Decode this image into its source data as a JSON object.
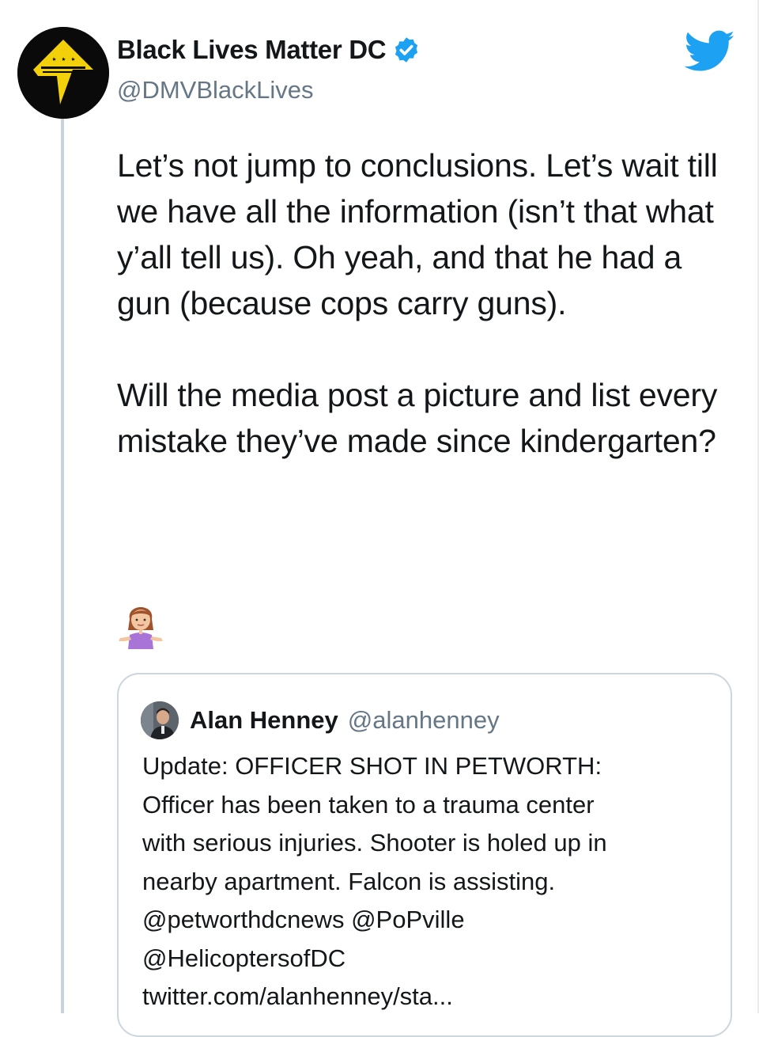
{
  "tweet": {
    "display_name": "Black Lives Matter DC",
    "handle": "@DMVBlackLives",
    "paragraph_1": "Let’s not jump to conclusions. Let’s wait till we have all the information (isn’t that what y’all tell us). Oh yeah, and that he had a gun (because cops carry guns).",
    "paragraph_2": "Will the media post a picture and list every mistake they’ve made since kindergarten?",
    "emoji": "person-shrugging-emoji",
    "verified_color": "#1da1f2",
    "brand_color": "#1da1f2",
    "avatar_accent": "#f2d00a"
  },
  "quoted_tweet": {
    "display_name": "Alan Henney",
    "handle": "@alanhenney",
    "lines": [
      "Update: OFFICER SHOT IN PETWORTH:",
      "Officer has been taken to a trauma center",
      "with serious injuries. Shooter is holed up in",
      "nearby apartment. Falcon is assisting.",
      "@petworthdcnews @PoPville",
      "@HelicoptersofDC",
      "twitter.com/alanhenney/sta..."
    ]
  }
}
